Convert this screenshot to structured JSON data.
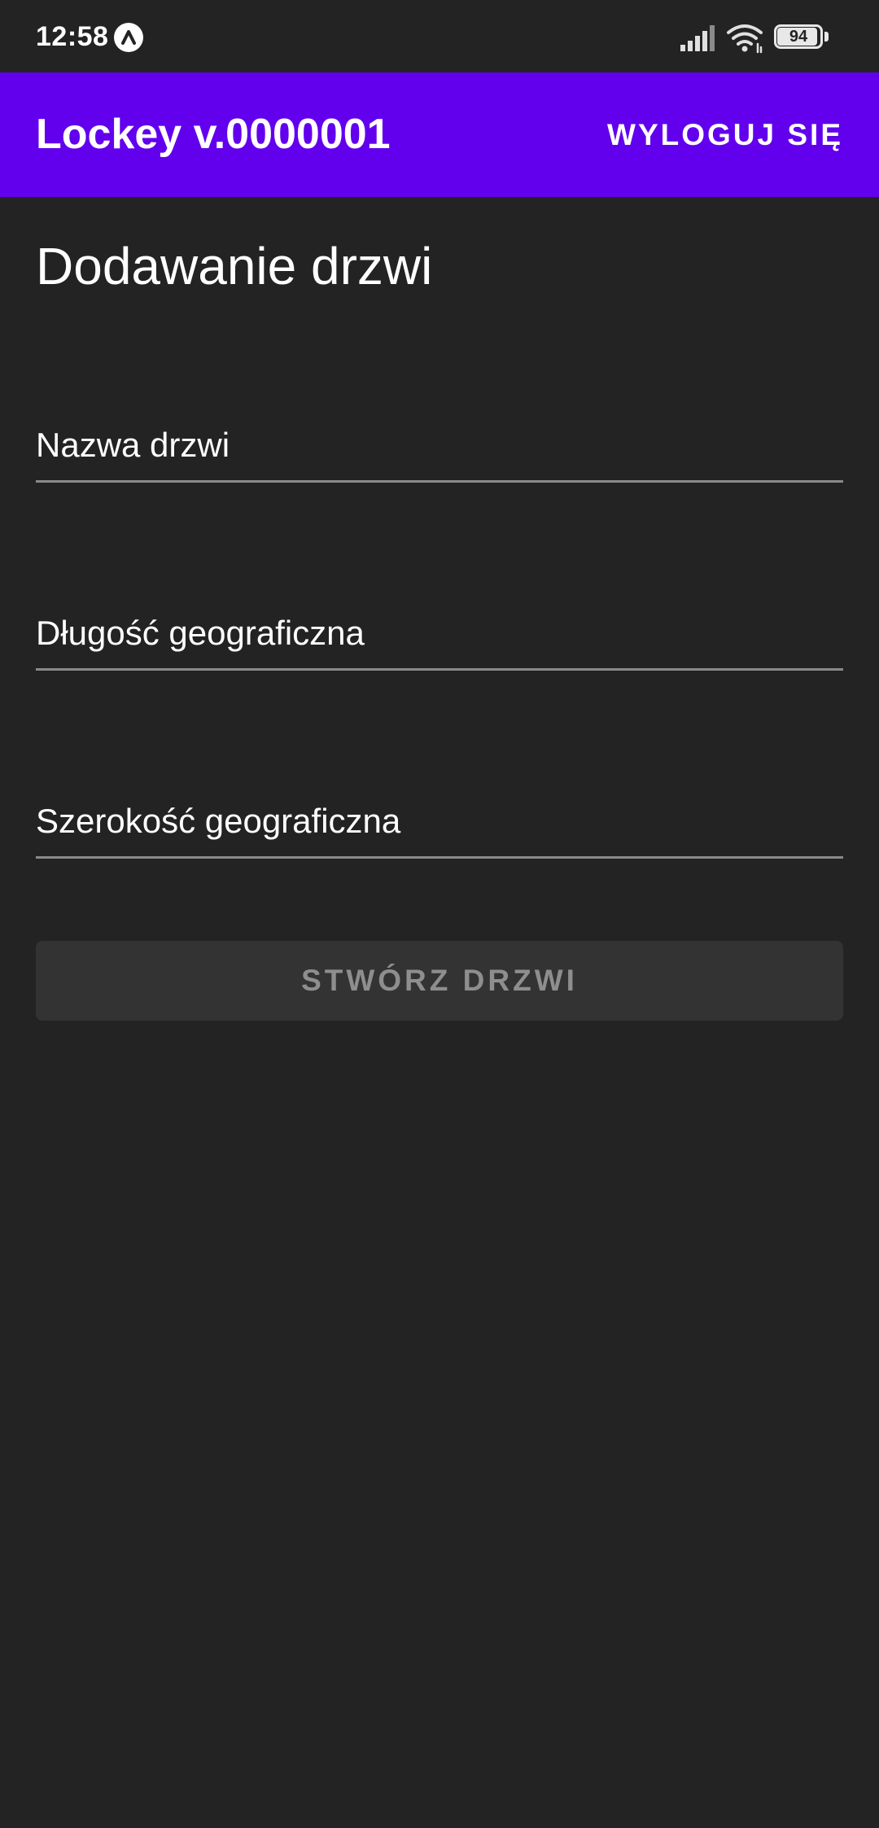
{
  "status_bar": {
    "time": "12:58",
    "battery_level": "94",
    "battery_fraction": 0.94,
    "icons": [
      "app-notification-icon",
      "signal-icon",
      "wifi-icon",
      "battery-icon"
    ]
  },
  "app_bar": {
    "title": "Lockey v.0000001",
    "logout_label": "WYLOGUJ SIĘ",
    "color": "#6200ee"
  },
  "page": {
    "title": "Dodawanie drzwi"
  },
  "form": {
    "door_name_placeholder": "Nazwa drzwi",
    "longitude_placeholder": "Długość geograficzna",
    "latitude_placeholder": "Szerokość geograficzna",
    "submit_label": "STWÓRZ DRZWI"
  },
  "colors": {
    "background": "#232323",
    "button_disabled": "#333333",
    "button_text_disabled": "#8e8e8e",
    "underline": "#8a8a8a"
  }
}
